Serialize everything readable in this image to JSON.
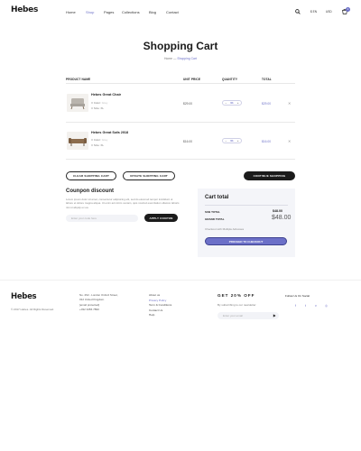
{
  "header": {
    "logo": "Hebes",
    "nav": [
      "Home",
      "Shop",
      "Pages",
      "Collections",
      "Blog",
      "Contact"
    ],
    "active_nav": "Shop",
    "currency": "$ EN",
    "language": "USD",
    "cart_count": "2"
  },
  "page": {
    "title": "Shopping Cart",
    "breadcrumb_home": "Home",
    "breadcrumb_sep": "—",
    "breadcrumb_current": "Shopping Cart"
  },
  "table": {
    "headers": [
      "PRODUCT NAME",
      "UNIT PRICE",
      "QUANTITY",
      "TOTAL"
    ],
    "rows": [
      {
        "name": "Hebes Great Chair",
        "color_label": "Color:",
        "color_value": "Grey",
        "size_label": "Size:",
        "size_value": "XL",
        "price": "$29.00",
        "qty": "01",
        "total": "$29.00"
      },
      {
        "name": "Hebes Great Sofa 2018",
        "color_label": "Color:",
        "color_value": "Grey",
        "size_label": "Size:",
        "size_value": "XL",
        "price": "$16.00",
        "qty": "01",
        "total": "$16.00"
      }
    ]
  },
  "actions": {
    "clear": "CLEAR SHOPPING CART",
    "update": "UPDATE SHOPPING CART",
    "continue": "CONTINUE SHOPPING"
  },
  "coupon": {
    "title": "Counpon discount",
    "text": "Lorem ipsum dolor sit amet, consectetur adipisicing elit, sed do eiusmod tempor incididunt ut labore et dolore magna aliqua. Ut enim ad minim veniam, quis nostrud exercitation ullamco laboris nisi ut aliquip ex ea.",
    "placeholder": "Enter your code here",
    "apply": "APPLY COUPON"
  },
  "cart_total": {
    "title": "Cart total",
    "subtotal_label": "SUB TOTAL",
    "subtotal_value": "$48.00",
    "grand_label": "GRAND TOTAL",
    "grand_value": "$48.00",
    "checkout_note": "Checkout with Multiple Adresses",
    "proceed": "PROCEED TO CHECKOUT"
  },
  "footer": {
    "logo": "Hebes",
    "copyright": "© 2017 Hebes. All Rights Reserved.",
    "address": [
      "No. 262 - London Oxford Street,",
      "012 United Kingdom.",
      "[email protected]",
      "+032 3456 7890"
    ],
    "links": [
      "About us",
      "Privacy Policy",
      "Term & Conditions",
      "Contact Us",
      "Help"
    ],
    "active_link": "Privacy Policy",
    "newsletter_title": "GET 20% OFF",
    "newsletter_text": "By subscribing to our newsletter",
    "email_placeholder": "Enter your email",
    "follow": "Follow Us On Social"
  }
}
